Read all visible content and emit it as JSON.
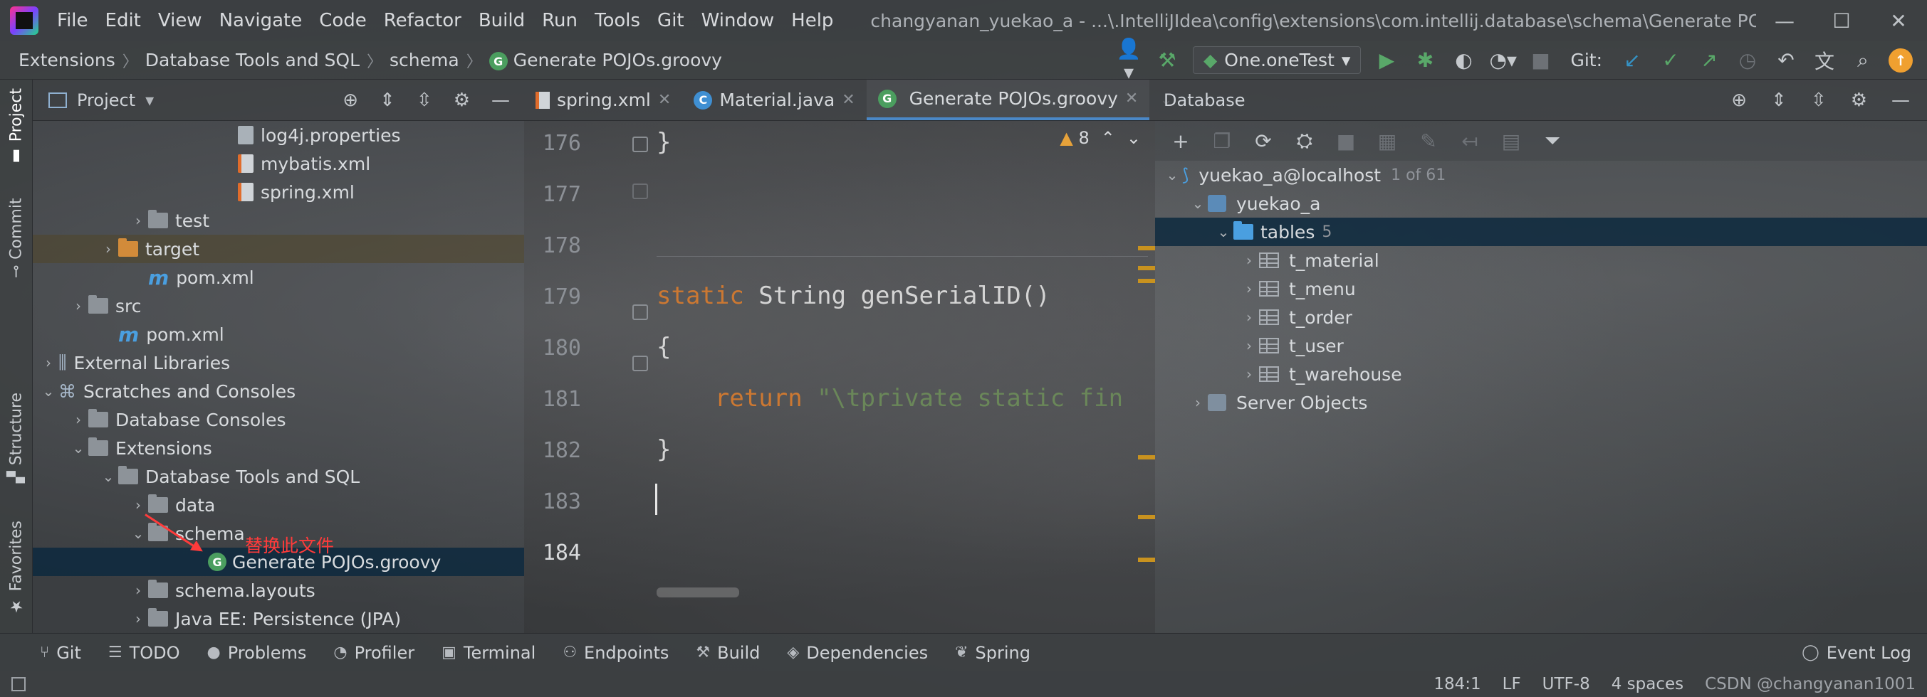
{
  "menubar": {
    "items": [
      "File",
      "Edit",
      "View",
      "Navigate",
      "Code",
      "Refactor",
      "Build",
      "Run",
      "Tools",
      "Git",
      "Window",
      "Help"
    ],
    "window_title": "changyanan_yuekao_a - ...\\.IntelliJIdea\\config\\extensions\\com.intellij.database\\schema\\Generate POJOs.groovy"
  },
  "breadcrumb": [
    "Extensions",
    "Database Tools and SQL",
    "schema",
    "Generate POJOs.groovy"
  ],
  "toolbar": {
    "run_config": "One.oneTest",
    "git_label": "Git:"
  },
  "left_strip": {
    "project": "Project",
    "commit": "Commit",
    "structure": "Structure",
    "favorites": "Favorites"
  },
  "project_panel": {
    "title": "Project",
    "rows": [
      {
        "label": "log4j.properties",
        "depth": 6,
        "kind": "props"
      },
      {
        "label": "mybatis.xml",
        "depth": 6,
        "kind": "xml"
      },
      {
        "label": "spring.xml",
        "depth": 6,
        "kind": "xml"
      },
      {
        "label": "test",
        "depth": 3,
        "kind": "folder",
        "chevron": "›"
      },
      {
        "label": "target",
        "depth": 2,
        "kind": "folder-orange",
        "chevron": "›",
        "highlight": true
      },
      {
        "label": "pom.xml",
        "depth": 3,
        "kind": "maven"
      },
      {
        "label": "src",
        "depth": 1,
        "kind": "folder",
        "chevron": "›"
      },
      {
        "label": "pom.xml",
        "depth": 2,
        "kind": "maven"
      },
      {
        "label": "External Libraries",
        "depth": 0,
        "kind": "lib",
        "chevron": "›"
      },
      {
        "label": "Scratches and Consoles",
        "depth": 0,
        "kind": "scratch",
        "chevron": "⌄"
      },
      {
        "label": "Database Consoles",
        "depth": 1,
        "kind": "folder",
        "chevron": "›"
      },
      {
        "label": "Extensions",
        "depth": 1,
        "kind": "folder",
        "chevron": "⌄"
      },
      {
        "label": "Database Tools and SQL",
        "depth": 2,
        "kind": "folder",
        "chevron": "⌄"
      },
      {
        "label": "data",
        "depth": 3,
        "kind": "folder",
        "chevron": "›"
      },
      {
        "label": "schema",
        "depth": 3,
        "kind": "folder",
        "chevron": "⌄"
      },
      {
        "label": "Generate POJOs.groovy",
        "depth": 5,
        "kind": "groovy",
        "selected": true
      },
      {
        "label": "schema.layouts",
        "depth": 3,
        "kind": "folder",
        "chevron": "›"
      },
      {
        "label": "Java EE: Persistence (JPA)",
        "depth": 3,
        "kind": "folder",
        "chevron": "›"
      }
    ],
    "annotation": "替换此文件"
  },
  "editor": {
    "tabs": [
      {
        "label": "spring.xml",
        "icon": "xml"
      },
      {
        "label": "Material.java",
        "icon": "class"
      },
      {
        "label": "Generate POJOs.groovy",
        "icon": "groovy",
        "active": true
      }
    ],
    "warning_count": "8",
    "lines": [
      {
        "n": "176",
        "code": [
          {
            "t": "}",
            "c": ""
          }
        ]
      },
      {
        "n": "177",
        "code": []
      },
      {
        "n": "178",
        "code": []
      },
      {
        "n": "179",
        "code": [
          {
            "t": "static ",
            "c": "kw"
          },
          {
            "t": "String genSerialID()",
            "c": ""
          }
        ]
      },
      {
        "n": "180",
        "code": [
          {
            "t": "{",
            "c": ""
          }
        ]
      },
      {
        "n": "181",
        "code": [
          {
            "t": "    return ",
            "c": "kw"
          },
          {
            "t": "\"\\tprivate static fin",
            "c": "str"
          }
        ]
      },
      {
        "n": "182",
        "code": [
          {
            "t": "}",
            "c": ""
          }
        ]
      },
      {
        "n": "183",
        "code": []
      },
      {
        "n": "184",
        "code": [],
        "current": true
      }
    ]
  },
  "database_panel": {
    "title": "Database",
    "datasource": "yuekao_a@localhost",
    "datasource_count": "1 of 61",
    "schema": "yuekao_a",
    "tables_label": "tables",
    "tables_count": "5",
    "tables": [
      "t_material",
      "t_menu",
      "t_order",
      "t_user",
      "t_warehouse"
    ],
    "server_objects": "Server Objects"
  },
  "bottom_tools": [
    "Git",
    "TODO",
    "Problems",
    "Profiler",
    "Terminal",
    "Endpoints",
    "Build",
    "Dependencies",
    "Spring"
  ],
  "bottom_tools_right": "Event Log",
  "status_bar": {
    "position": "184:1",
    "line_sep": "LF",
    "encoding": "UTF-8",
    "indent": "4 spaces",
    "watermark": "CSDN @changyanan1001"
  },
  "colors": {
    "keyword": "#cc7832",
    "string": "#6a8759",
    "selection": "#0d293e",
    "accent": "#4a88c7"
  }
}
